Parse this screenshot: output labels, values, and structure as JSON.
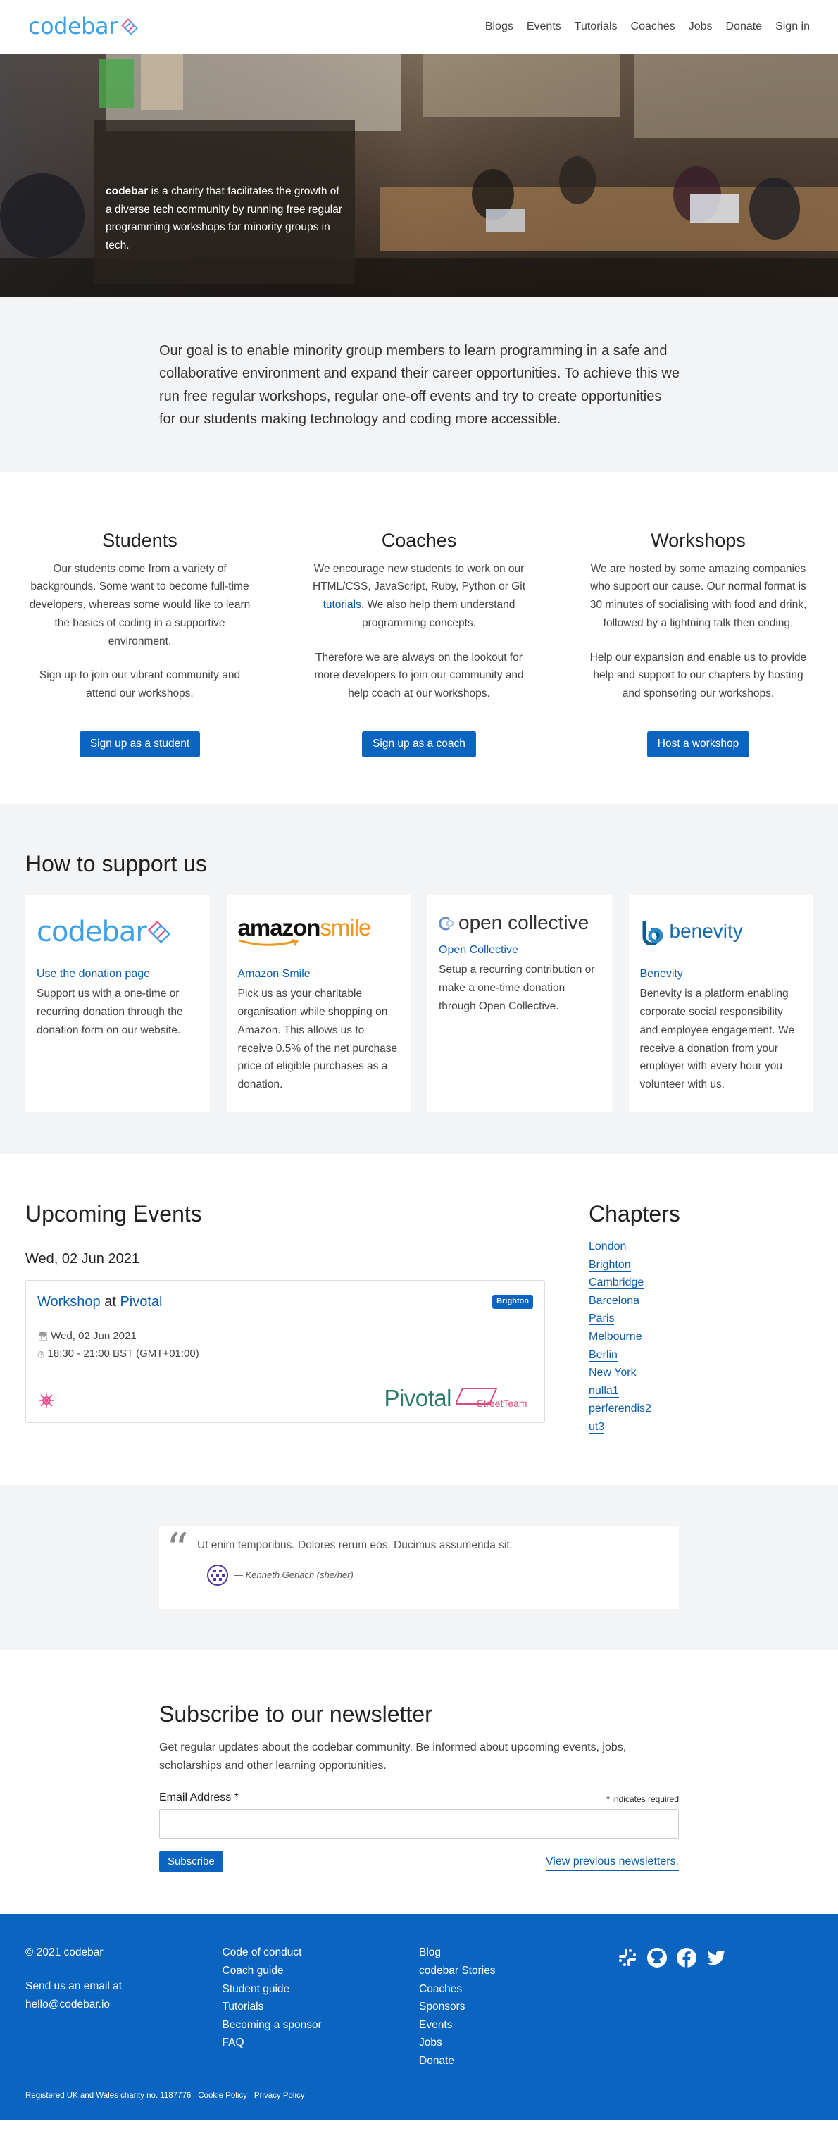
{
  "nav": {
    "logo_text": "codebar",
    "links": [
      "Blogs",
      "Events",
      "Tutorials",
      "Coaches",
      "Jobs",
      "Donate",
      "Sign in"
    ]
  },
  "hero": {
    "bold": "codebar",
    "text": " is a charity that facilitates the growth of a diverse tech community by running free regular programming workshops for minority groups in tech."
  },
  "goal": {
    "text": "Our goal is to enable minority group members to learn programming in a safe and collaborative environment and expand their career opportunities. To achieve this we run free regular workshops, regular one-off events and try to create opportunities for our students making technology and coding more accessible."
  },
  "students": {
    "title": "Students",
    "p1": "Our students come from a variety of backgrounds. Some want to become full-time developers, whereas some would like to learn the basics of coding in a supportive environment.",
    "p2": "Sign up to join our vibrant community and attend our workshops.",
    "button": "Sign up as a student"
  },
  "coaches": {
    "title": "Coaches",
    "p1a": "We encourage new students to work on our HTML/CSS, JavaScript, Ruby, Python or Git ",
    "p1_link": "tutorials",
    "p1b": ". We also help them understand programming concepts.",
    "p2": "Therefore we are always on the lookout for more developers to join our community and help coach at our workshops.",
    "button": "Sign up as a coach"
  },
  "workshops": {
    "title": "Workshops",
    "p1": "We are hosted by some amazing companies who support our cause. Our normal format is 30 minutes of socialising with food and drink, followed by a lightning talk then coding.",
    "p2": "Help our expansion and enable us to provide help and support to our chapters by hosting and sponsoring our workshops.",
    "button": "Host a workshop"
  },
  "support": {
    "title": "How to support us",
    "cards": [
      {
        "logo": "codebar",
        "link": "Use the donation page",
        "text": "Support us with a one-time or recurring donation through the donation form on our website."
      },
      {
        "logo_main": "amazon",
        "logo_accent": "smile",
        "link": "Amazon Smile",
        "text": "Pick us as your charitable organisation while shopping on Amazon. This allows us to receive 0.5% of the net purchase price of eligible purchases as a donation."
      },
      {
        "logo": "open collective",
        "link": "Open Collective",
        "text": "Setup a recurring contribution or make a one-time donation through Open Collective."
      },
      {
        "logo": "benevity",
        "link": "Benevity",
        "text": "Benevity is a platform enabling corporate social responsibility and employee engagement. We receive a donation from your employer with every hour you volunteer with us."
      }
    ]
  },
  "events": {
    "title": "Upcoming Events",
    "date_heading": "Wed, 02 Jun 2021",
    "event": {
      "type": "Workshop",
      "at": " at ",
      "host": "Pivotal",
      "badge": "Brighton",
      "date": "Wed, 02 Jun 2021",
      "time": "18:30 - 21:00 BST (GMT+01:00)",
      "sponsor_main": "Pivotal",
      "sponsor_sub": "StreetTeam"
    }
  },
  "chapters": {
    "title": "Chapters",
    "items": [
      "London",
      "Brighton",
      "Cambridge",
      "Barcelona",
      "Paris",
      "Melbourne",
      "Berlin",
      "New York",
      "nulla1",
      "perferendis2",
      "ut3"
    ]
  },
  "testimonial": {
    "quote": "Ut enim temporibus. Dolores rerum eos. Ducimus assumenda sit.",
    "author": "— Kenneth Gerlach (she/her)"
  },
  "newsletter": {
    "title": "Subscribe to our newsletter",
    "desc": "Get regular updates about the codebar community. Be informed about upcoming events, jobs, scholarships and other learning opportunities.",
    "email_label": "Email Address *",
    "required_note": "* indicates required",
    "button": "Subscribe",
    "previous": "View previous newsletters."
  },
  "footer": {
    "copyright": "© 2021 codebar",
    "email_intro": "Send us an email at",
    "email": "hello@codebar.io",
    "col2": [
      "Code of conduct",
      "Coach guide",
      "Student guide",
      "Tutorials",
      "Becoming a sponsor",
      "FAQ"
    ],
    "col3": [
      "Blog",
      "codebar Stories",
      "Coaches",
      "Sponsors",
      "Events",
      "Jobs",
      "Donate"
    ],
    "social_icons": [
      "slack-icon",
      "github-icon",
      "facebook-icon",
      "twitter-icon"
    ],
    "charity": "Registered UK and Wales charity no. 1187776",
    "cookie": "Cookie Policy",
    "privacy": "Privacy Policy"
  },
  "colors": {
    "primary": "#0b64c0",
    "logo": "#3aa0e8",
    "section_bg": "#f3f4f6"
  }
}
